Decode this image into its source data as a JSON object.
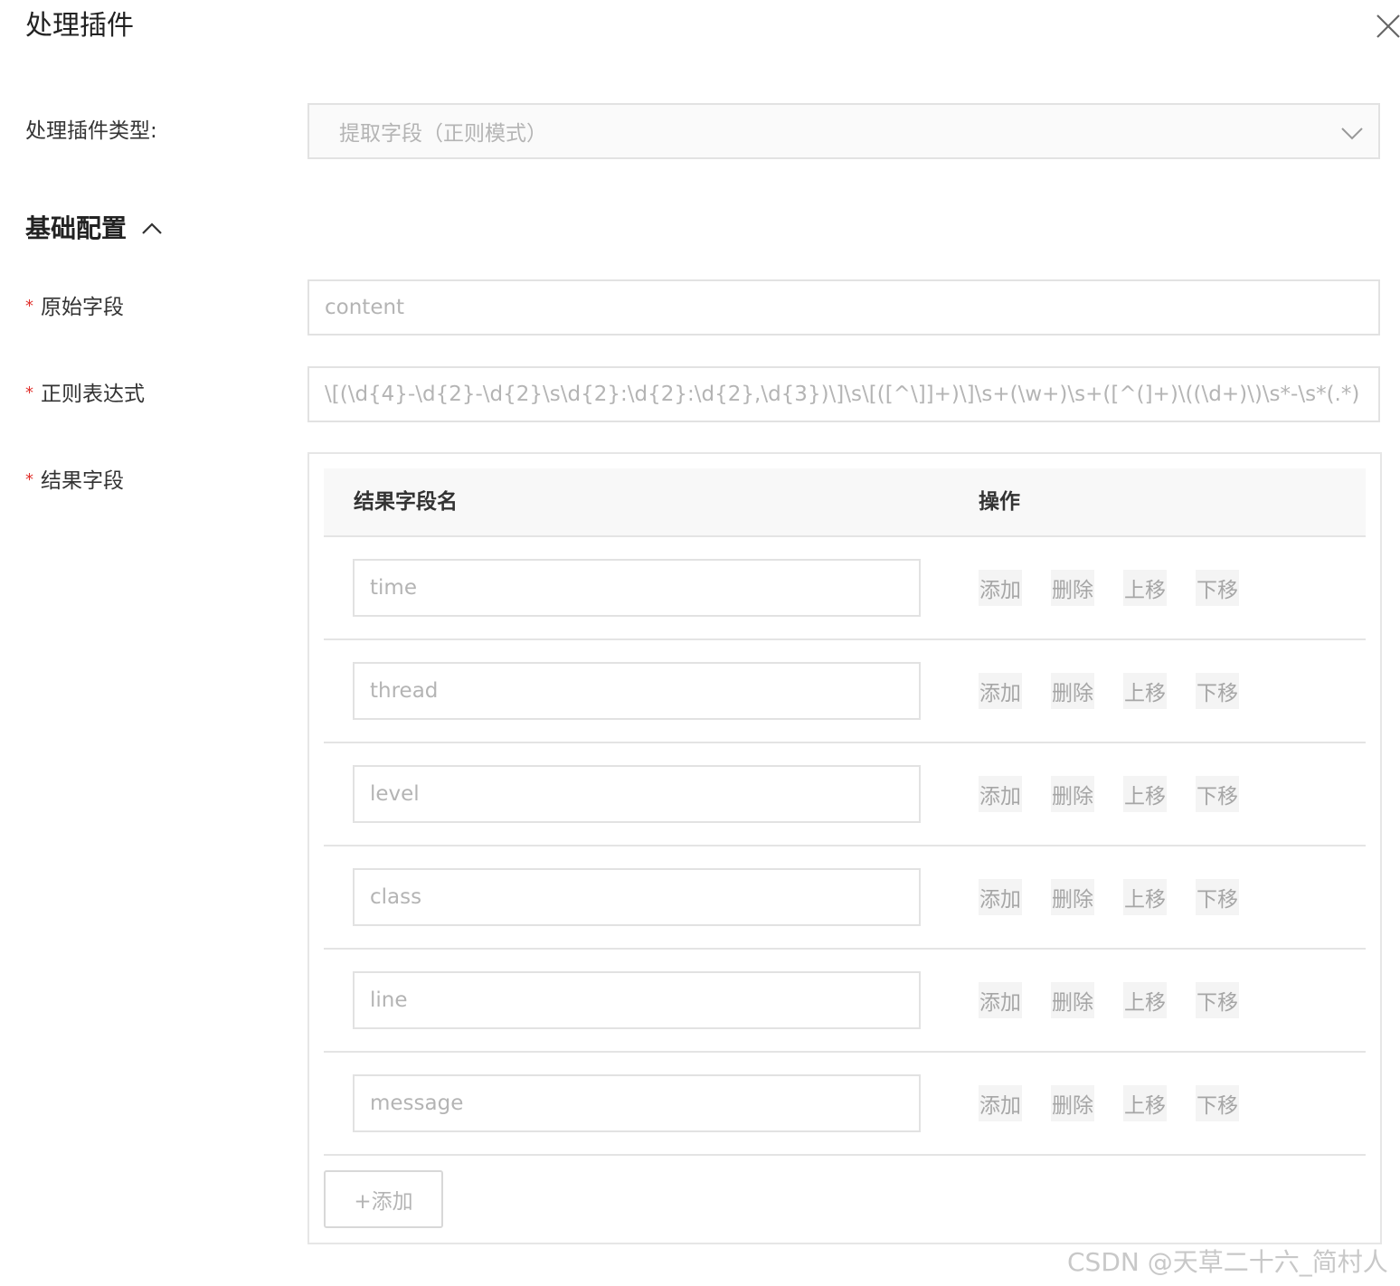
{
  "dialog": {
    "title": "处理插件"
  },
  "plugin_type": {
    "label": "处理插件类型:",
    "value": "提取字段（正则模式）"
  },
  "section": {
    "title": "基础配置"
  },
  "form": {
    "source_field": {
      "label": "原始字段",
      "value": "content"
    },
    "regex": {
      "label": "正则表达式",
      "value": "\\[(\\d{4}-\\d{2}-\\d{2}\\s\\d{2}:\\d{2}:\\d{2},\\d{3})\\]\\s\\[([^\\]]+)\\]\\s+(\\w+)\\s+([^(]+)\\((\\d+)\\)\\s*-\\s*(.*)"
    },
    "result_fields": {
      "label": "结果字段",
      "col_name": "结果字段名",
      "col_actions": "操作",
      "rows": [
        {
          "value": "time"
        },
        {
          "value": "thread"
        },
        {
          "value": "level"
        },
        {
          "value": "class"
        },
        {
          "value": "line"
        },
        {
          "value": "message"
        }
      ],
      "actions": {
        "add": "添加",
        "delete": "删除",
        "up": "上移",
        "down": "下移"
      },
      "add_button": "+添加"
    }
  },
  "watermark": "CSDN @天草二十六_简村人",
  "icons": {
    "close": "close-icon",
    "select": "chevron-down-icon",
    "section": "chevron-up-icon"
  }
}
